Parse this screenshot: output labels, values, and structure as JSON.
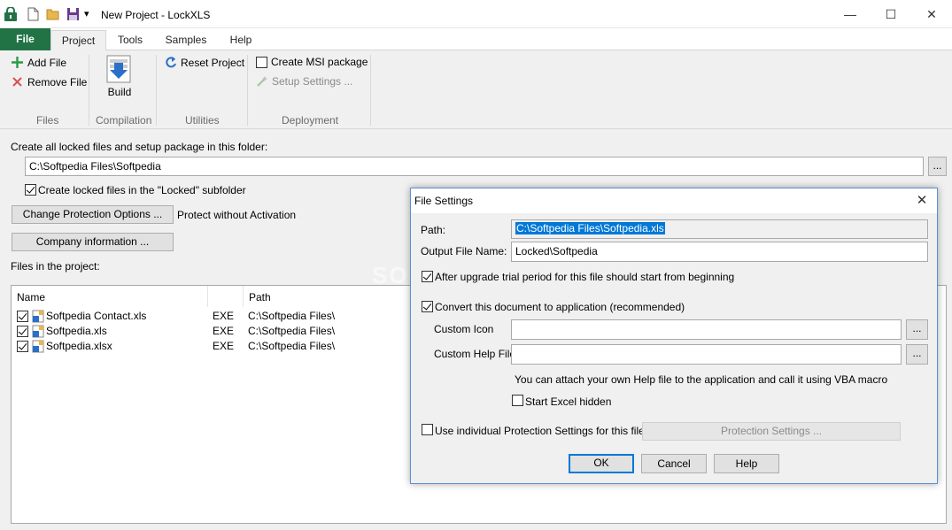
{
  "window": {
    "title": "New Project - LockXLS",
    "controls": {
      "minimize": "—",
      "maximize": "☐",
      "close": "✕"
    }
  },
  "quick_access": {
    "dropdown": "▾"
  },
  "ribbon": {
    "tabs": [
      "File",
      "Project",
      "Tools",
      "Samples",
      "Help"
    ],
    "active_tab": "Project",
    "files": {
      "add_file": "Add File",
      "remove_file": "Remove File",
      "group": "Files"
    },
    "compilation": {
      "build": "Build",
      "group": "Compilation"
    },
    "utilities": {
      "reset_project": "Reset Project",
      "group": "Utilities"
    },
    "deployment": {
      "create_msi": "Create MSI package",
      "setup_settings": "Setup Settings ...",
      "group": "Deployment"
    }
  },
  "main": {
    "folder_label": "Create all locked files and setup package in this folder:",
    "folder_value": "C:\\Softpedia Files\\Softpedia",
    "browse": "...",
    "locked_subfolder": "Create locked files in the \"Locked\" subfolder",
    "change_protection": "Change Protection Options ...",
    "protection_status": "Protect without Activation",
    "company_info": "Company information ...",
    "files_label": "Files in the project:"
  },
  "file_list": {
    "columns": [
      "Name",
      "",
      "Path"
    ],
    "rows": [
      {
        "name": "Softpedia Contact.xls",
        "type": "EXE",
        "path": "C:\\Softpedia Files\\"
      },
      {
        "name": "Softpedia.xls",
        "type": "EXE",
        "path": "C:\\Softpedia Files\\"
      },
      {
        "name": "Softpedia.xlsx",
        "type": "EXE",
        "path": "C:\\Softpedia Files\\"
      }
    ]
  },
  "dialog": {
    "title": "File Settings",
    "close": "✕",
    "path_label": "Path:",
    "path_value": "C:\\Softpedia Files\\Softpedia.xls",
    "output_label": "Output File Name:",
    "output_value": "Locked\\Softpedia",
    "trial_restart": "After upgrade trial period for this file should start from beginning",
    "convert": "Convert this document to application (recommended)",
    "custom_icon": "Custom Icon",
    "custom_help": "Custom Help File",
    "browse": "...",
    "help_note": "You can attach your own Help file to the application and call it using VBA macro",
    "start_hidden": "Start Excel hidden",
    "individual": "Use individual Protection Settings for this file",
    "protection_settings": "Protection Settings ...",
    "ok": "OK",
    "cancel": "Cancel",
    "help": "Help"
  },
  "watermark": "SOFTPEDIA",
  "colors": {
    "file_tab": "#217346",
    "accent": "#0078d7"
  }
}
